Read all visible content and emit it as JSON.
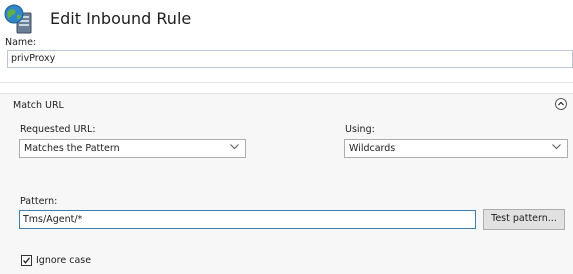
{
  "header": {
    "title": "Edit Inbound Rule"
  },
  "name_field": {
    "label": "Name:",
    "value": "privProxy"
  },
  "match_url": {
    "section_title": "Match URL",
    "requested_url": {
      "label": "Requested URL:",
      "selected": "Matches the Pattern"
    },
    "using": {
      "label": "Using:",
      "selected": "Wildcards"
    },
    "pattern": {
      "label": "Pattern:",
      "value": "Tms/Agent/*"
    },
    "test_pattern_label": "Test pattern...",
    "ignore_case": {
      "label": "Ignore case",
      "checked": true
    }
  },
  "icons": [
    "globe-server-icon",
    "chevron-down-icon",
    "collapse-icon",
    "checkmark-icon"
  ],
  "colors": {
    "focus_border": "#3c7fb1",
    "section_bg": "#f7f7f7"
  }
}
